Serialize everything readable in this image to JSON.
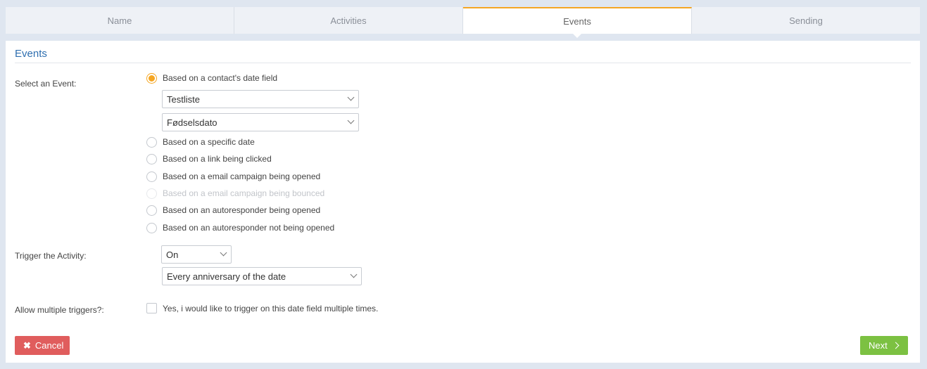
{
  "tabs": [
    {
      "label": "Name"
    },
    {
      "label": "Activities"
    },
    {
      "label": "Events"
    },
    {
      "label": "Sending"
    }
  ],
  "panel": {
    "title": "Events"
  },
  "select_event": {
    "label": "Select an Event:",
    "options": [
      {
        "label": "Based on a contact's date field"
      },
      {
        "label": "Based on a specific date"
      },
      {
        "label": "Based on a link being clicked"
      },
      {
        "label": "Based on a email campaign being opened"
      },
      {
        "label": "Based on a email campaign being bounced"
      },
      {
        "label": "Based on an autoresponder being opened"
      },
      {
        "label": "Based on an autoresponder not being opened"
      }
    ],
    "list_select": "Testliste",
    "field_select": "Fødselsdato"
  },
  "trigger": {
    "label": "Trigger the Activity:",
    "when_select": "On",
    "freq_select": "Every anniversary of the date"
  },
  "multiple": {
    "label": "Allow multiple triggers?:",
    "checkbox_label": "Yes, i would like to trigger on this date field multiple times."
  },
  "buttons": {
    "cancel": "Cancel",
    "next": "Next"
  },
  "colors": {
    "accent": "#f5a623",
    "title": "#2f6fb0",
    "cancel": "#e05d5d",
    "next": "#7cc142"
  }
}
